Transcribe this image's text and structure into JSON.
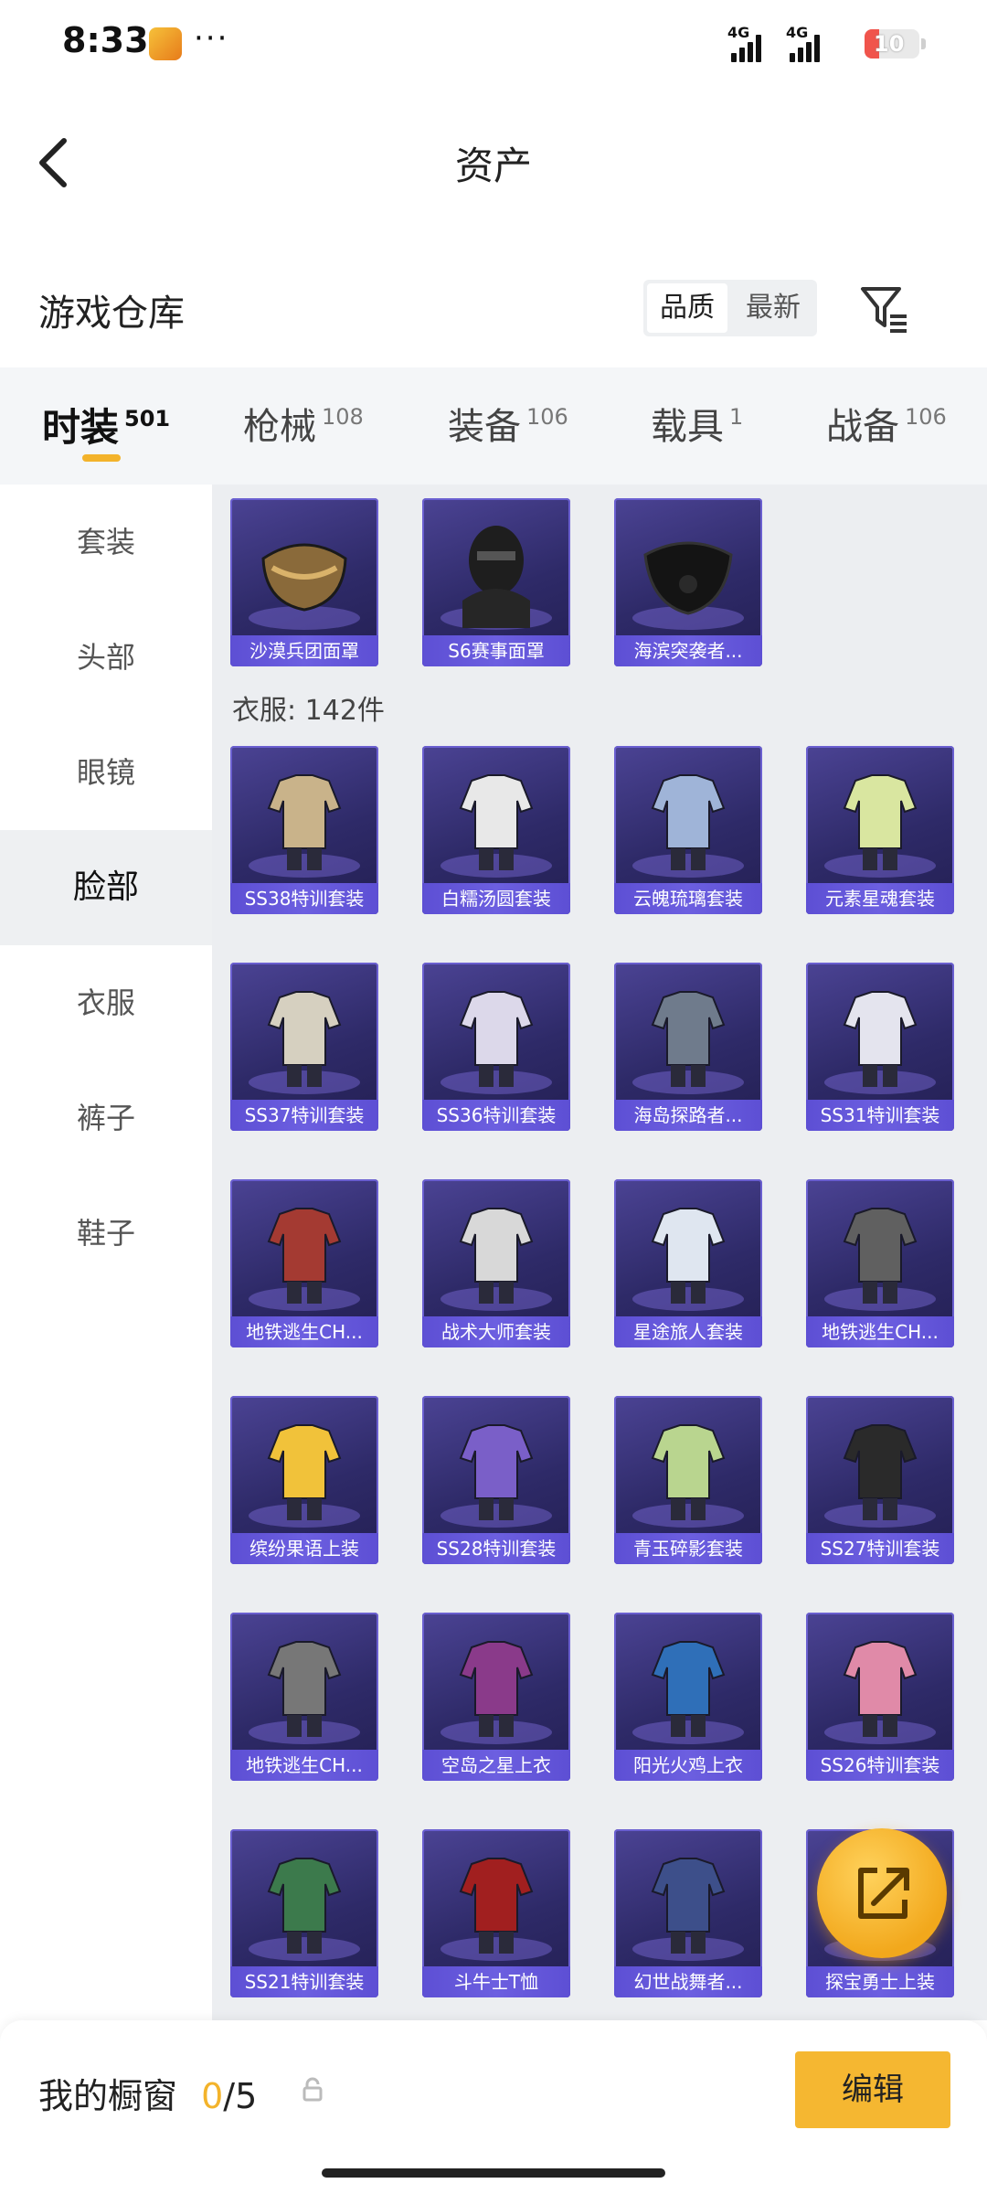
{
  "status_bar": {
    "time": "8:33",
    "more": "···",
    "network_1": "4G",
    "network_2": "4G",
    "battery": "10"
  },
  "header": {
    "title": "资产"
  },
  "warehouse": {
    "title": "游戏仓库",
    "sort_quality": "品质",
    "sort_newest": "最新"
  },
  "tabs": [
    {
      "label": "时装",
      "count": "501"
    },
    {
      "label": "枪械",
      "count": "108"
    },
    {
      "label": "装备",
      "count": "106"
    },
    {
      "label": "载具",
      "count": "1"
    },
    {
      "label": "战备",
      "count": "106"
    }
  ],
  "sidebar": {
    "items": [
      {
        "label": "套装"
      },
      {
        "label": "头部"
      },
      {
        "label": "眼镜"
      },
      {
        "label": "脸部"
      },
      {
        "label": "衣服"
      },
      {
        "label": "裤子"
      },
      {
        "label": "鞋子"
      }
    ]
  },
  "face_items": [
    {
      "name": "沙漠兵团面罩"
    },
    {
      "name": "S6赛事面罩"
    },
    {
      "name": "海滨突袭者..."
    }
  ],
  "clothes_section": {
    "label": "衣服: 142件"
  },
  "clothes_items": [
    {
      "name": "SS38特训套装"
    },
    {
      "name": "白糯汤圆套装"
    },
    {
      "name": "云魄琉璃套装"
    },
    {
      "name": "元素星魂套装"
    },
    {
      "name": "SS37特训套装"
    },
    {
      "name": "SS36特训套装"
    },
    {
      "name": "海岛探路者..."
    },
    {
      "name": "SS31特训套装"
    },
    {
      "name": "地铁逃生CH..."
    },
    {
      "name": "战术大师套装"
    },
    {
      "name": "星途旅人套装"
    },
    {
      "name": "地铁逃生CH..."
    },
    {
      "name": "缤纷果语上装"
    },
    {
      "name": "SS28特训套装"
    },
    {
      "name": "青玉碎影套装"
    },
    {
      "name": "SS27特训套装"
    },
    {
      "name": "地铁逃生CH..."
    },
    {
      "name": "空岛之星上衣"
    },
    {
      "name": "阳光火鸡上衣"
    },
    {
      "name": "SS26特训套装"
    },
    {
      "name": "SS21特训套装"
    },
    {
      "name": "斗牛士T恤"
    },
    {
      "name": "幻世战舞者..."
    },
    {
      "name": "探宝勇士上装"
    }
  ],
  "bottom_bar": {
    "showcase_label": "我的橱窗",
    "showcase_current": "0",
    "showcase_total": "/5",
    "edit_label": "编辑"
  },
  "colors": {
    "accent": "#f3b32b",
    "card_bg": "#2e2a68",
    "card_label": "#5d4fd4"
  }
}
